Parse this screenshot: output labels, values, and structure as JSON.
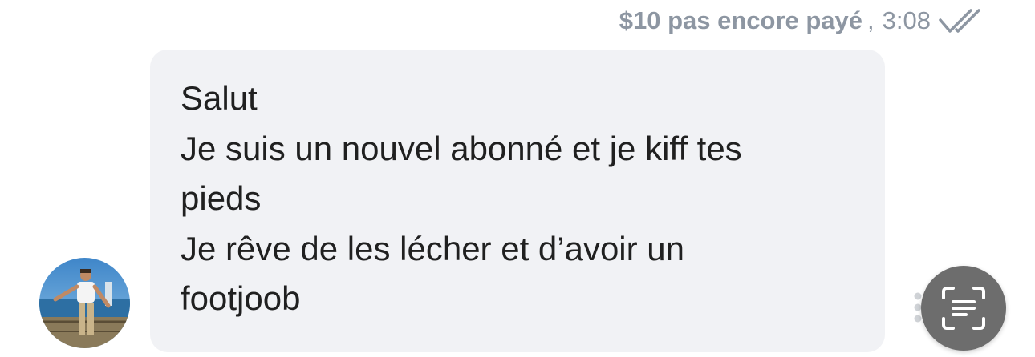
{
  "message_meta": {
    "price_status": "$10 pas encore payé",
    "separator": ",",
    "time": "3:08",
    "read_receipt_icon": "double-check-icon"
  },
  "message": {
    "lines": [
      "Salut",
      "Je suis un nouvel abonné et je kiff tes",
      "pieds",
      "Je rêve de les lécher et d’avoir un",
      "footjoob"
    ]
  },
  "sender": {
    "avatar_icon": "profile-photo"
  },
  "controls": {
    "more_icon": "vertical-dots-icon",
    "scan_text_icon": "text-scan-icon"
  },
  "colors": {
    "meta_text": "#8d96a2",
    "bubble_bg": "#f1f2f5",
    "message_text": "#202020",
    "fab_bg": "#6d6d6d"
  }
}
